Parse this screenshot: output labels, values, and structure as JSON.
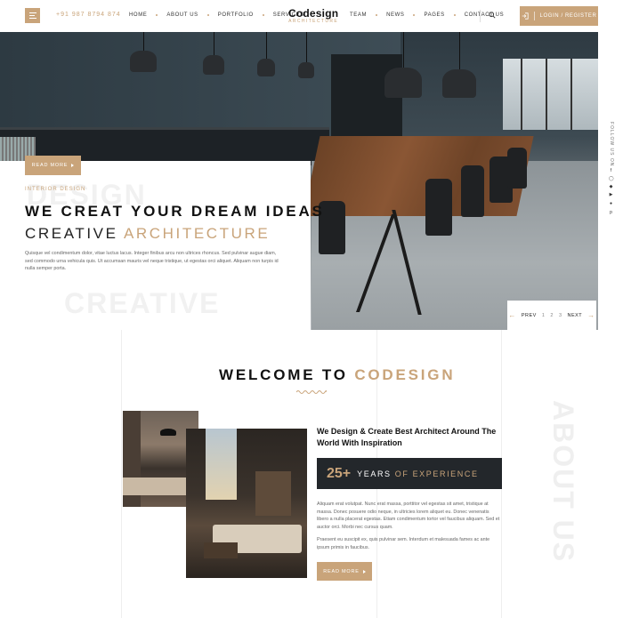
{
  "header": {
    "phone": "+91 987 8794 874",
    "nav_left": [
      "HOME",
      "ABOUT US",
      "PORTFOLIO",
      "SERVICES"
    ],
    "nav_right": [
      "TEAM",
      "NEWS",
      "PAGES",
      "CONTACT US"
    ],
    "logo_title": "Codesign",
    "logo_sub": "ARCHITECTURE",
    "login_label": "LOGIN / REGISTER"
  },
  "hero": {
    "tag": "INTERIOR DESIGN",
    "ghost_top": "DESIGN",
    "ghost_bottom": "CREATIVE",
    "title": "WE CREAT YOUR DREAM IDEAS",
    "subtitle_plain": "CREATIVE",
    "subtitle_accent": "ARCHITECTURE",
    "text": "Quisque vel condimentum dolor, vitae luctus lacus. Integer finibus arcu non ultrices rhoncus. Sed pulvinar augue diam, sed commodo urna vehicula quis. Ut accumsan mauris vel neque tristique, ut egestas orci aliquet. Aliquam non turpis id nulla semper porta.",
    "read_more": "READ MORE"
  },
  "slider": {
    "prev": "PREV",
    "pages": [
      "1",
      "2",
      "3"
    ],
    "next": "NEXT"
  },
  "social": {
    "follow": "FOLLOW US ON",
    "icons": [
      "facebook-icon",
      "instagram-icon",
      "twitter-icon",
      "youtube-icon",
      "skype-icon",
      "pinterest-icon"
    ]
  },
  "welcome": {
    "title_plain": "WELCOME TO",
    "title_accent": "CODESIGN",
    "about_ghost": "ABOUT US",
    "heading": "We Design & Create Best Architect Around The World With Inspiration",
    "exp_number": "25+",
    "exp_plain": "YEARS",
    "exp_accent": "OF EXPERIENCE",
    "para1": "Aliquam erat volutpat. Nunc erat massa, porttitor vel egestas sit amet, tristique at massa. Donec posuere odio neque, in ultricies lorem aliquet eu. Donec venenatis libero a nulla placerat egestas. Etiam condimentum tortor vel faucibus aliquam. Sed et auctor orci. Morbi nec cursus quam.",
    "para2": "Praesent eu suscipit ex, quis pulvinar sem. Interdum et malesuada fames ac ante ipsum primis in faucibus.",
    "read_more": "READ MORE"
  },
  "colors": {
    "accent": "#c9a47a",
    "dark": "#23272b"
  }
}
